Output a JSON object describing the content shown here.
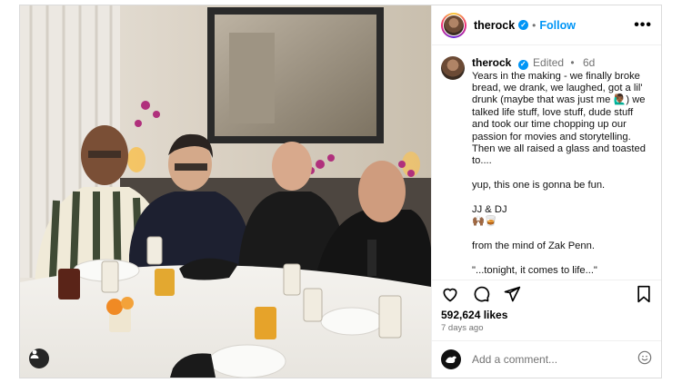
{
  "post": {
    "username": "therock",
    "follow_label": "Follow",
    "separator": "•",
    "more_label": "•••",
    "verified_mark": "✓",
    "edited_label": "Edited",
    "age": "6d",
    "caption": "Years in the making - we finally broke bread, we drank, we laughed, got a lil' drunk (maybe that was just me 🙋🏾‍♂️) we talked life stuff, love stuff, dude stuff and took our time chopping up our passion for movies and storytelling. Then we all raised a glass and toasted to....\n\nyup, this one is gonna be fun.\n\nJJ & DJ\n🙌🏾🥃\n\nfrom the mind of Zak Penn.\n\n\"...tonight, it comes to life...\"",
    "likes": "592,624 likes",
    "posted_ago": "7 days ago"
  },
  "comment_box": {
    "placeholder": "Add a comment..."
  },
  "icons": {
    "like": "heart-icon",
    "comment": "comment-icon",
    "share": "share-icon",
    "save": "bookmark-icon",
    "emoji": "emoji-icon",
    "tag": "user-tag-icon"
  },
  "colors": {
    "accent": "#0095f6",
    "muted": "#737373",
    "border": "#dbdbdb"
  }
}
